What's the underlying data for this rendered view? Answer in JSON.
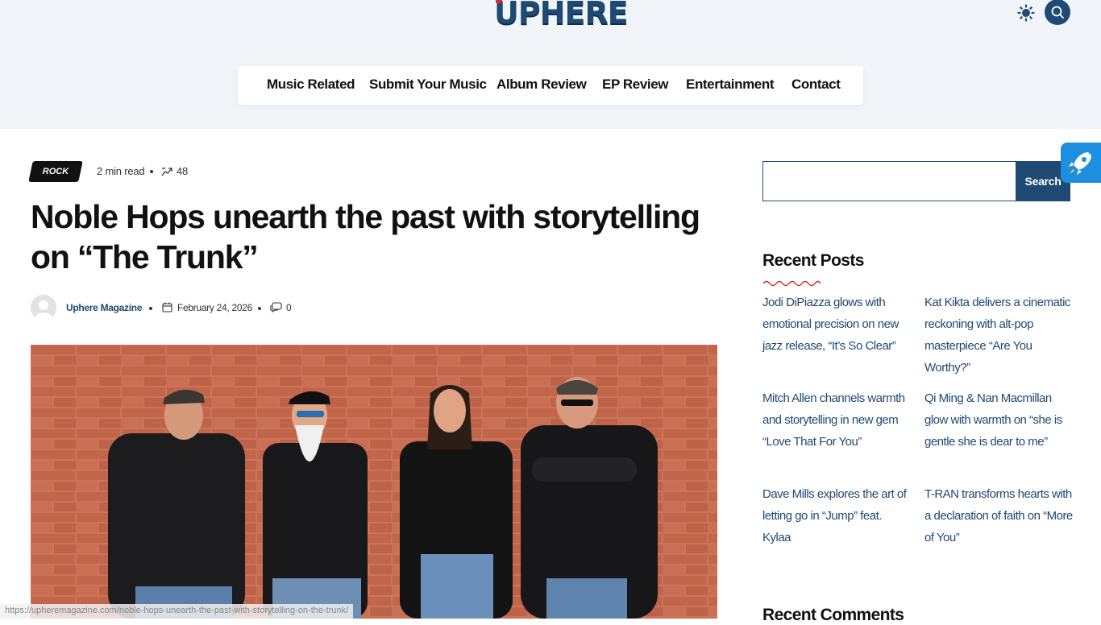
{
  "header": {
    "logo_text": "UPHERE",
    "nav": [
      "Music Related",
      "Submit Your Music",
      "Album Review",
      "EP Review",
      "Entertainment",
      "Contact"
    ]
  },
  "article": {
    "category": "ROCK",
    "read_time": "2 min read",
    "views": "48",
    "title": "Noble Hops unearth the past with storytelling on “The Trunk”",
    "author": "Uphere Magazine",
    "date": "February 24, 2026",
    "comments": "0"
  },
  "sidebar": {
    "search_button": "Search",
    "search_placeholder": "",
    "recent_posts_title": "Recent Posts",
    "recent_posts": [
      "Jodi DiPiazza glows with emotional precision on new jazz release, “It’s So Clear”",
      "Kat Kikta delivers a cinematic reckoning with alt-pop masterpiece “Are You Worthy?”",
      "Mitch Allen channels warmth and storytelling in new gem “Love That For You”",
      "Qi Ming & Nan Macmillan glow with warmth on “she is gentle she is dear to me”",
      "Dave Mills explores the art of letting go in “Jump” feat. Kylaa",
      "T-RAN transforms hearts with a declaration of faith on “More of You”"
    ],
    "recent_comments_title": "Recent Comments"
  },
  "status_bar_url": "https://upheremagazine.com/noble-hops-unearth-the-past-with-storytelling-on-the-trunk/",
  "colors": {
    "brand": "#1e4a73",
    "header_bg": "#f1f5fa",
    "accent_red": "#d9262c",
    "rocket": "#1e8fe0"
  },
  "icons": [
    "sun-icon",
    "search-icon",
    "trend-icon",
    "calendar-icon",
    "comment-icon",
    "rocket-icon"
  ]
}
